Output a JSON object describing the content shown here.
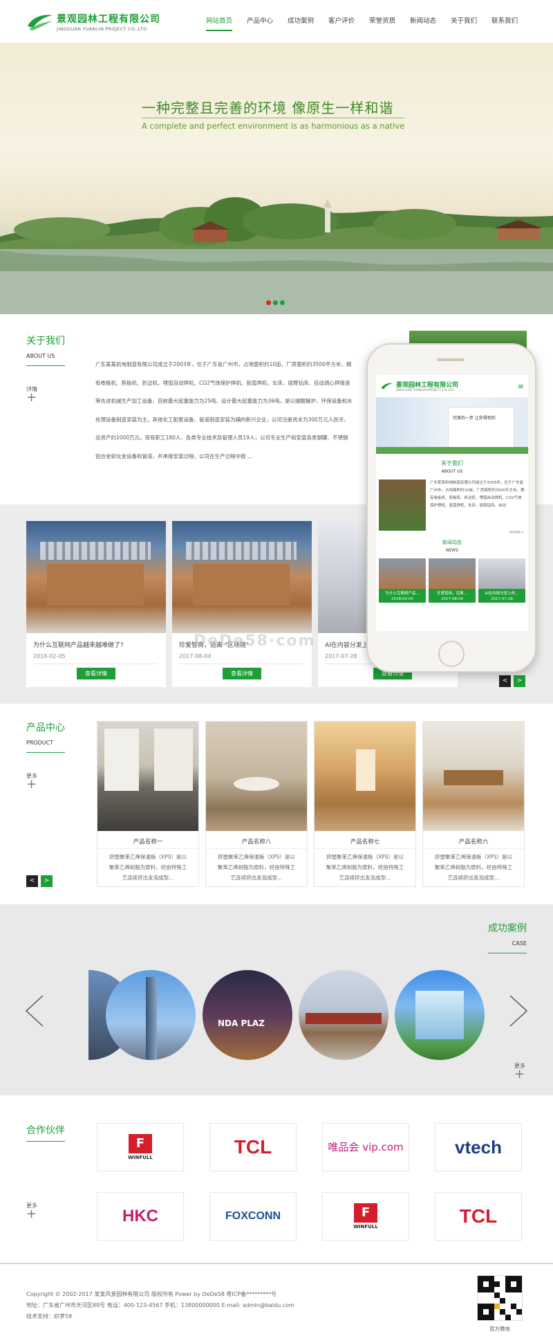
{
  "brand": {
    "name_cn": "景观园林工程有限公司",
    "name_en": "JINGGUAN YUANLIN PROJECT CO.,LTD",
    "accent": "#1e9e37"
  },
  "nav": {
    "items": [
      "网站首页",
      "产品中心",
      "成功案例",
      "客户评价",
      "荣誉资质",
      "新闻动态",
      "关于我们",
      "联系我们"
    ]
  },
  "banner": {
    "title": "一种完整且完善的环境  像原生一样和谐",
    "subtitle": "A complete and perfect environment is as harmonious as a native"
  },
  "about": {
    "title": "关于我们",
    "title_en": "ABOUT US",
    "more": "详情",
    "lines": [
      "广东某某机电制造有限公司成立于2003年，位于广东省广州市，占地面积约10亩，厂房面积约3500平方米，拥",
      "有卷板机、剪板机、折边机、埋弧自动焊机、CO2气体保护焊机、氩弧焊机、车床、摇臂钻床、自动调心焊接滚",
      "等先进机械生产加工设备，目前最大起重能力为25吨、设计最大起重能力为36吨，是以烟酸解炉、环保设备和水",
      "处理设备制造安装为主，其他化工配套设备、管道制造安装为辅的新兴企业，公司注册资本为300万元人民币，",
      "总资产约1000万元，现有职工180人、各类专业技术及管理人员19人，公司专业生产和安装各类钢罐、不锈钢",
      "铝合金软化金设备和管道，并承接安装过程，公司在生产过程中按 ..."
    ]
  },
  "news": {
    "btn": "查看详情",
    "items": [
      {
        "title": "为什么互联网产品越来越难做了?",
        "date": "2018-02-05"
      },
      {
        "title": "珍爱智商，远离 \"区块链\"",
        "date": "2017-08-04"
      },
      {
        "title": "AI在内容分发上...",
        "date": "2017-07-28"
      }
    ],
    "prev": "<",
    "next": ">"
  },
  "watermark": "DeDe58·com",
  "phone": {
    "about_title": "关于我们",
    "about_en": "ABOUT US",
    "about_text": "广东某某机电制造有限公司成立于2003年。位于广东省广州市。占地面积约10亩，厂房面积约3500平方米。拥有卷板机、剪板机、折边机、埋弧自动焊机、CO2气体保护焊机、氩弧焊机、车床、摇臂钻床，自动",
    "more": "MORE+",
    "news_title": "新闻动态",
    "news_en": "NEWS",
    "news": [
      {
        "title": "为什么互联网产品...",
        "date": "2018-02-05"
      },
      {
        "title": "珍爱智商，远离...",
        "date": "2017-08-04"
      },
      {
        "title": "AI在内容分发上的...",
        "date": "2017-07-28"
      }
    ],
    "ad_text": "完美的一步 让你得到的"
  },
  "products": {
    "title": "产品中心",
    "title_en": "PRODUCT",
    "more": "更多",
    "items": [
      {
        "name": "产品名称一",
        "desc": [
          "挤塑聚苯乙烯保温板（XPS）是以",
          "聚苯乙烯树脂为原料，经由特殊工",
          "艺连续挤出发泡成型..."
        ]
      },
      {
        "name": "产品名称八",
        "desc": [
          "挤塑聚苯乙烯保温板（XPS）是以",
          "聚苯乙烯树脂为原料，经由特殊工",
          "艺连续挤出发泡成型..."
        ]
      },
      {
        "name": "产品名称七",
        "desc": [
          "挤塑聚苯乙烯保温板（XPS）是以",
          "聚苯乙烯树脂为原料，经由特殊工",
          "艺连续挤出发泡成型..."
        ]
      },
      {
        "name": "产品名称六",
        "desc": [
          "挤塑聚苯乙烯保温板（XPS）是以",
          "聚苯乙烯树脂为原料，经由特殊工",
          "艺连续挤出发泡成型..."
        ]
      }
    ],
    "prev": "<",
    "next": ">"
  },
  "cases": {
    "title": "成功案例",
    "title_en": "CASE",
    "more": "更多",
    "sign_text": "NDA PLAZ"
  },
  "partners": {
    "title": "合作伙伴",
    "more": "更多",
    "logos": [
      "WINFULL",
      "TCL",
      "唯品会 vip.com",
      "vtech",
      "HKC",
      "FOXCONN",
      "WINFULL",
      "TCL"
    ]
  },
  "footer": {
    "copyright": "Copyright © 2002-2017 某某风景园林有限公司 版权所有 Power by DeDe58 粤ICP备*********号",
    "address": "地址：广东省广州市天河区88号    电话：400-123-4567    手机：13800000000    E-mail: admin@baidu.com",
    "support": "技术支持：织梦58",
    "qr_label": "官方微信"
  }
}
